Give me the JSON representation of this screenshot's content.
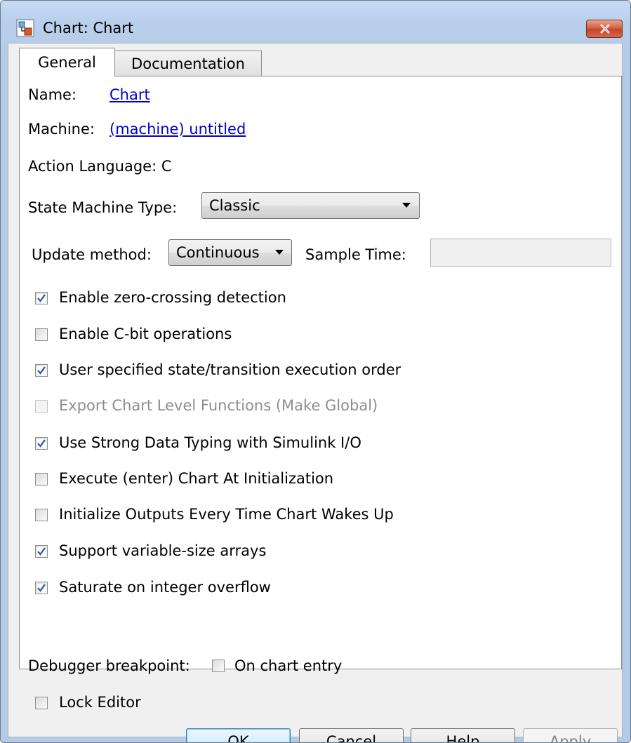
{
  "window": {
    "title": "Chart: Chart",
    "icon": "chart-app-icon",
    "close_icon": "close-icon"
  },
  "tabs": [
    {
      "label": "General",
      "selected": true
    },
    {
      "label": "Documentation",
      "selected": false
    }
  ],
  "general": {
    "name_label": "Name:",
    "name_value": "Chart",
    "machine_label": "Machine:",
    "machine_value": "(machine) untitled",
    "action_language": "Action Language:  C",
    "state_machine_type_label": "State Machine Type:",
    "state_machine_type_value": "Classic",
    "update_method_label": "Update method:",
    "update_method_value": "Continuous",
    "sample_time_label": "Sample Time:",
    "sample_time_value": "",
    "options": [
      {
        "label": "Enable zero-crossing detection",
        "checked": true,
        "enabled": true
      },
      {
        "label": "Enable C-bit operations",
        "checked": false,
        "enabled": true
      },
      {
        "label": "User specified state/transition execution order",
        "checked": true,
        "enabled": true
      },
      {
        "label": "Export Chart Level Functions (Make Global)",
        "checked": false,
        "enabled": false
      },
      {
        "label": "Use Strong Data Typing with Simulink I/O",
        "checked": true,
        "enabled": true
      },
      {
        "label": "Execute (enter) Chart At Initialization",
        "checked": false,
        "enabled": true
      },
      {
        "label": "Initialize Outputs Every Time Chart Wakes Up",
        "checked": false,
        "enabled": true
      },
      {
        "label": "Support variable-size arrays",
        "checked": true,
        "enabled": true
      },
      {
        "label": "Saturate on integer overflow",
        "checked": true,
        "enabled": true
      }
    ],
    "debugger_label": "Debugger breakpoint:",
    "debugger_option": {
      "label": "On chart entry",
      "checked": false
    },
    "lock_editor": {
      "label": "Lock Editor",
      "checked": false
    }
  },
  "buttons": {
    "ok": "OK",
    "cancel": "Cancel",
    "help": "Help",
    "apply": "Apply"
  },
  "colors": {
    "link": "#0000cc",
    "check": "#3a5ea8",
    "disabled_text": "#8d8d8d"
  }
}
